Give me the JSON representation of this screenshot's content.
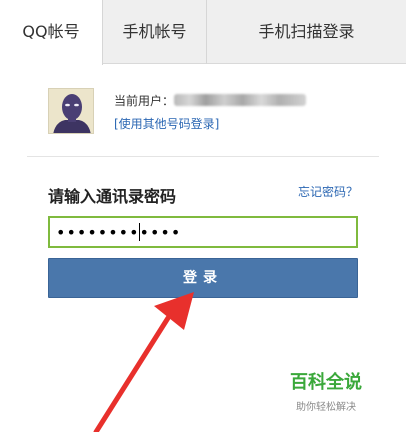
{
  "tabs": [
    {
      "label": "QQ帐号",
      "active": true
    },
    {
      "label": "手机帐号",
      "active": false
    },
    {
      "label": "手机扫描登录",
      "active": false
    }
  ],
  "user": {
    "current_label": "当前用户：",
    "use_other_label": "[使用其他号码登录]"
  },
  "password": {
    "label": "请输入通讯录密码",
    "forgot_label": "忘记密码？",
    "value": "••••••••••••"
  },
  "login_button": {
    "label": "登录"
  },
  "watermark": {
    "title": "百科全说",
    "subtitle": "助你轻松解决"
  },
  "colors": {
    "accent_blue": "#4a77ab",
    "input_border_green": "#7fba3e",
    "link_blue": "#2b67b3",
    "arrow_red": "#e8302c",
    "watermark_green": "#3aa83a"
  }
}
